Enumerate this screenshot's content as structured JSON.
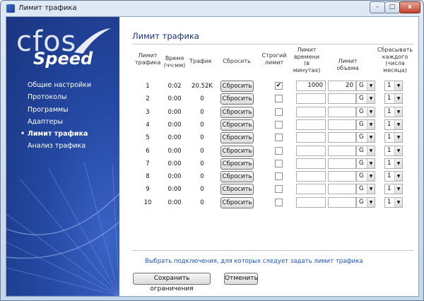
{
  "window": {
    "title": "Лимит трафика",
    "controls": {
      "minimize": "–",
      "maximize": "□",
      "close": "x"
    }
  },
  "logo": {
    "brand_top": "cfos",
    "brand_bottom": "Speed"
  },
  "sidebar": {
    "items": [
      {
        "label": "Общие настройки",
        "active": false
      },
      {
        "label": "Протоколы",
        "active": false
      },
      {
        "label": "Программы",
        "active": false
      },
      {
        "label": "Адаптеры",
        "active": false
      },
      {
        "label": "Лимит трафика",
        "active": true
      },
      {
        "label": "Анализ трафика",
        "active": false
      }
    ]
  },
  "main": {
    "title": "Лимит трафика",
    "columns": {
      "limit": "Лимит трафика",
      "time": "Время (чч:мм)",
      "traffic": "Трафик",
      "reset": "Сбросить",
      "strict": "Строгий лимит",
      "time_limit": "Лимит времени (в минутах)",
      "volume_limit": "Лимит объема",
      "reset_each": "Сбрасывать каждого (числа месяца)"
    },
    "rows": [
      {
        "num": "1",
        "time": "0:02",
        "traffic": "20.52K",
        "reset": "Сбросить",
        "strict": true,
        "time_limit": "1000",
        "volume": "20",
        "unit": "G",
        "day": "1"
      },
      {
        "num": "2",
        "time": "0:00",
        "traffic": "0",
        "reset": "Сбросить",
        "strict": false,
        "time_limit": "",
        "volume": "",
        "unit": "G",
        "day": "1"
      },
      {
        "num": "3",
        "time": "0:00",
        "traffic": "0",
        "reset": "Сбросить",
        "strict": false,
        "time_limit": "",
        "volume": "",
        "unit": "G",
        "day": "1"
      },
      {
        "num": "4",
        "time": "0:00",
        "traffic": "0",
        "reset": "Сбросить",
        "strict": false,
        "time_limit": "",
        "volume": "",
        "unit": "G",
        "day": "1"
      },
      {
        "num": "5",
        "time": "0:00",
        "traffic": "0",
        "reset": "Сбросить",
        "strict": false,
        "time_limit": "",
        "volume": "",
        "unit": "G",
        "day": "1"
      },
      {
        "num": "6",
        "time": "0:00",
        "traffic": "0",
        "reset": "Сбросить",
        "strict": false,
        "time_limit": "",
        "volume": "",
        "unit": "G",
        "day": "1"
      },
      {
        "num": "7",
        "time": "0:00",
        "traffic": "0",
        "reset": "Сбросить",
        "strict": false,
        "time_limit": "",
        "volume": "",
        "unit": "G",
        "day": "1"
      },
      {
        "num": "8",
        "time": "0:00",
        "traffic": "0",
        "reset": "Сбросить",
        "strict": false,
        "time_limit": "",
        "volume": "",
        "unit": "G",
        "day": "1"
      },
      {
        "num": "9",
        "time": "0:00",
        "traffic": "0",
        "reset": "Сбросить",
        "strict": false,
        "time_limit": "",
        "volume": "",
        "unit": "G",
        "day": "1"
      },
      {
        "num": "10",
        "time": "0:00",
        "traffic": "0",
        "reset": "Сбросить",
        "strict": false,
        "time_limit": "",
        "volume": "",
        "unit": "G",
        "day": "1"
      }
    ],
    "link": "Выбрать подключения, для которых следует задать лимит трафика"
  },
  "footer": {
    "save": "Сохранить ограничения",
    "cancel": "Отменить"
  },
  "icons": {
    "dropdown_arrow": "▼",
    "check_mark": "✔"
  },
  "colors": {
    "sidebar": "#2448a2",
    "title": "#1a3080",
    "link": "#1a55c8"
  }
}
